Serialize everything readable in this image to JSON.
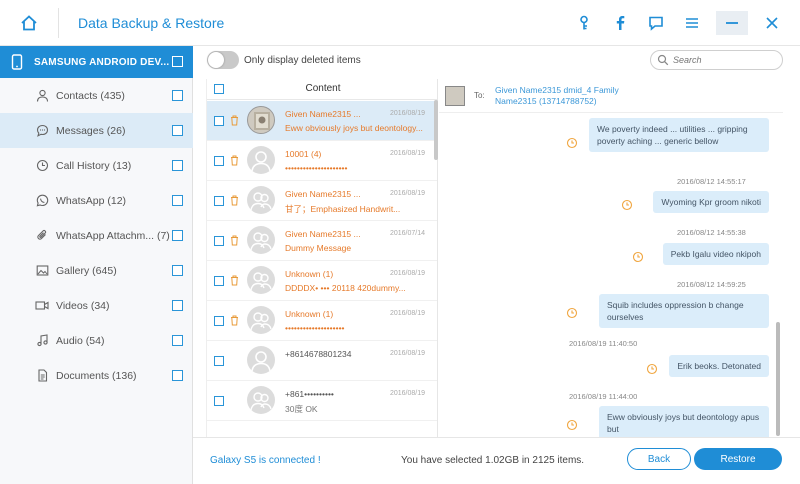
{
  "window": {
    "title": "Data Backup & Restore",
    "icons": [
      "home-icon",
      "key-icon",
      "facebook-icon",
      "feedback-icon",
      "menu-icon",
      "minimize-icon",
      "close-icon"
    ]
  },
  "sidebar": {
    "device": "SAMSUNG ANDROID DEV...",
    "items": [
      {
        "label": "Contacts (435)",
        "icon": "contact-icon"
      },
      {
        "label": "Messages (26)",
        "icon": "message-icon",
        "active": true
      },
      {
        "label": "Call History (13)",
        "icon": "clock-icon"
      },
      {
        "label": "WhatsApp (12)",
        "icon": "whatsapp-icon"
      },
      {
        "label": "WhatsApp Attachm... (7)",
        "icon": "paperclip-icon"
      },
      {
        "label": "Gallery (645)",
        "icon": "image-icon"
      },
      {
        "label": "Videos (34)",
        "icon": "video-icon"
      },
      {
        "label": "Audio (54)",
        "icon": "music-icon"
      },
      {
        "label": "Documents (136)",
        "icon": "document-icon"
      }
    ]
  },
  "toolbar": {
    "toggle_label": "Only display deleted items",
    "search_placeholder": "Search"
  },
  "list": {
    "header": "Content",
    "rows": [
      {
        "name": "Given Name2315 ...",
        "date": "2016/08/19",
        "preview": "Eww obviously joys but deontology...",
        "deleted": true,
        "selected": true,
        "avatar": "photo"
      },
      {
        "name": "10001 (4)",
        "date": "2016/08/19",
        "preview": "•••••••••••••••••••••",
        "deleted": true
      },
      {
        "name": "Given Name2315 ...",
        "date": "2016/08/19",
        "preview": "甘了；Emphasized Handwrit...",
        "deleted": true
      },
      {
        "name": "Given Name2315 ...",
        "date": "2016/07/14",
        "preview": "Dummy Message",
        "deleted": true
      },
      {
        "name": "Unknown (1)",
        "date": "2016/08/19",
        "preview": "DDDDX• ••• 20118 420dummy...",
        "deleted": true
      },
      {
        "name": "Unknown (1)",
        "date": "2016/08/19",
        "preview": "••••••••••••••••••••",
        "deleted": true
      },
      {
        "name": "+8614678801234",
        "date": "2016/08/19",
        "preview": "",
        "deleted": false
      },
      {
        "name": "+861••••••••••",
        "date": "2016/08/19",
        "preview": "30度 OK",
        "deleted": false
      }
    ]
  },
  "conversation": {
    "to_label": "To:",
    "recipient": "Given Name2315 dmid_4 Family Name2315 (13714788752)",
    "messages": [
      {
        "text": "We poverty indeed ... utilities ... gripping poverty aching ... generic bellow",
        "ts": ""
      },
      {
        "ts": "2016/08/12 14:55:17",
        "text": "Wyoming Kpr groom nikoti"
      },
      {
        "ts": "2016/08/12 14:55:38",
        "text": "Pekb Igalu video nkipoh"
      },
      {
        "ts": "2016/08/12 14:59:25",
        "text": "Squib includes oppression b change ourselves"
      },
      {
        "ts": "2016/08/19 11:40:50",
        "text": "Erik beoks. Detonated"
      },
      {
        "ts": "2016/08/19 11:44:00",
        "text": "Eww obviously joys but deontology apus but"
      }
    ]
  },
  "footer": {
    "connected": "Galaxy S5 is connected",
    "connected_mark": "!",
    "selected": "You have selected 1.02GB in 2125 items.",
    "back": "Back",
    "restore": "Restore"
  },
  "colors": {
    "accent": "#1f8dd6",
    "deleted": "#e67a2a",
    "bubble": "#dbedfa"
  }
}
